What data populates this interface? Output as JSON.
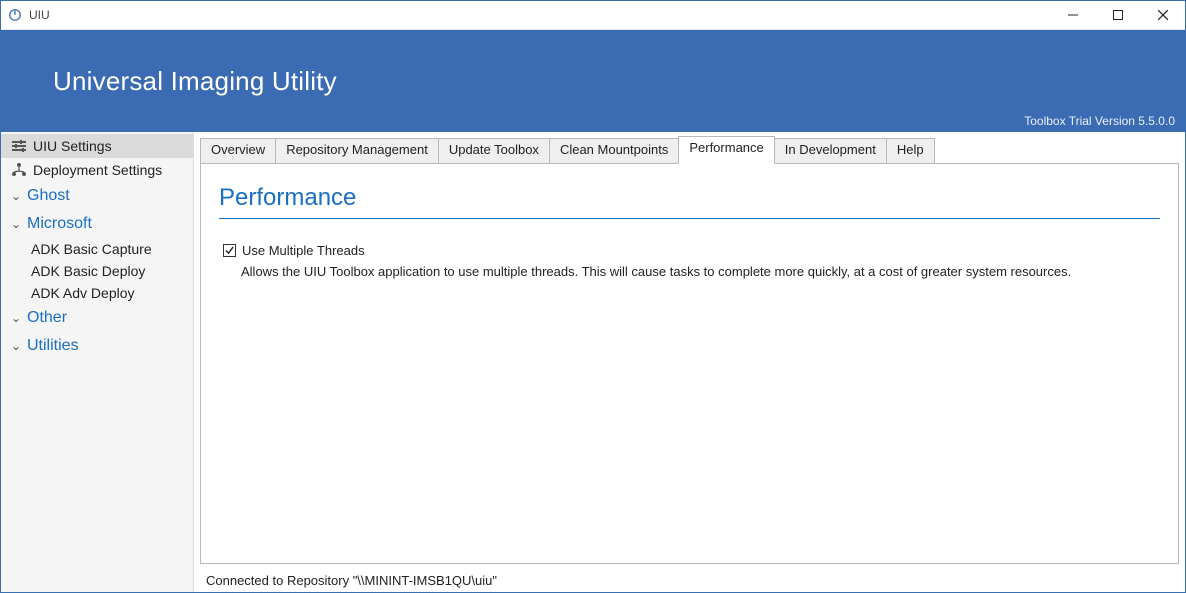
{
  "window": {
    "title": "UIU"
  },
  "banner": {
    "product_name": "Universal Imaging Utility",
    "version_text": "Toolbox Trial Version 5.5.0.0"
  },
  "sidebar": {
    "items": [
      {
        "label": "UIU Settings",
        "selected": true
      },
      {
        "label": "Deployment Settings",
        "selected": false
      }
    ],
    "groups": [
      {
        "label": "Ghost",
        "expanded": false,
        "children": []
      },
      {
        "label": "Microsoft",
        "expanded": true,
        "children": [
          {
            "label": "ADK Basic Capture"
          },
          {
            "label": "ADK Basic Deploy"
          },
          {
            "label": "ADK Adv Deploy"
          }
        ]
      },
      {
        "label": "Other",
        "expanded": false,
        "children": []
      },
      {
        "label": "Utilities",
        "expanded": false,
        "children": []
      }
    ]
  },
  "tabs": [
    {
      "label": "Overview"
    },
    {
      "label": "Repository Management"
    },
    {
      "label": "Update Toolbox"
    },
    {
      "label": "Clean Mountpoints"
    },
    {
      "label": "Performance",
      "active": true
    },
    {
      "label": "In Development"
    },
    {
      "label": "Help"
    }
  ],
  "page": {
    "title": "Performance",
    "checkbox": {
      "label": "Use Multiple Threads",
      "checked": true
    },
    "description": "Allows the UIU Toolbox application to use multiple threads. This will cause tasks to complete more quickly, at a cost of greater system resources."
  },
  "status": {
    "text": "Connected to Repository \"\\\\MININT-IMSB1QU\\uiu\""
  }
}
